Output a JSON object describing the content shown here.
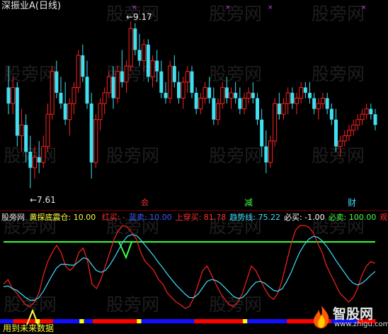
{
  "title": "深振业A(日线)",
  "price_high_label": "←9.17",
  "price_low_label": "←7.61",
  "signal_marks": {
    "red": "会",
    "jian": "减",
    "cai": "财"
  },
  "indicator_header": {
    "source_label": "股旁网",
    "name": "黄探底震仓:",
    "value": "10.00",
    "items": [
      {
        "label": "红买:",
        "value": "-",
        "color": "#ff3030"
      },
      {
        "label": "蓝卖:",
        "value": "10.00",
        "color": "#3a5bff"
      },
      {
        "label": "上穿买:",
        "value": "81.78",
        "color": "#ff3030"
      },
      {
        "label": "趋势线:",
        "value": "75.22",
        "color": "#40e0ff"
      },
      {
        "label": "必买:",
        "value": "-1.00",
        "color": "#ffffff"
      },
      {
        "label": "必卖:",
        "value": "100.00",
        "color": "#40ff40"
      },
      {
        "label": "观:",
        "value": "",
        "color": "#ff3030"
      }
    ]
  },
  "bottom_text": "用到未来数据",
  "watermark": "股旁网",
  "logo": {
    "name": "智股网",
    "url": "www.zhigu.com"
  },
  "colors": {
    "up": "#ff2020",
    "down": "#40e0f0",
    "green_line": "#40ff40",
    "red_line": "#ff2020",
    "cyan_line": "#40e0ff",
    "bar_blue": "#1010ff",
    "bar_red": "#ff0000",
    "bar_yellow": "#ffff00"
  },
  "chart_data": [
    {
      "type": "candlestick",
      "title": "深振业A(日线)",
      "annotations": [
        {
          "text": "9.17",
          "kind": "high"
        },
        {
          "text": "7.61",
          "kind": "low"
        }
      ],
      "candles": [
        [
          8.55,
          8.75,
          8.3,
          8.4
        ],
        [
          8.4,
          8.65,
          8.3,
          8.55
        ],
        [
          8.55,
          8.6,
          8.0,
          8.1
        ],
        [
          8.1,
          8.35,
          7.95,
          8.2
        ],
        [
          8.2,
          8.3,
          7.85,
          7.95
        ],
        [
          7.95,
          8.1,
          7.61,
          7.8
        ],
        [
          7.8,
          8.0,
          7.7,
          7.9
        ],
        [
          7.9,
          8.05,
          7.75,
          7.85
        ],
        [
          7.85,
          8.1,
          7.8,
          8.0
        ],
        [
          8.0,
          8.4,
          7.95,
          8.3
        ],
        [
          8.3,
          8.75,
          8.25,
          8.7
        ],
        [
          8.7,
          8.8,
          8.45,
          8.5
        ],
        [
          8.5,
          8.65,
          8.35,
          8.4
        ],
        [
          8.4,
          8.6,
          8.2,
          8.25
        ],
        [
          8.25,
          8.45,
          8.1,
          8.4
        ],
        [
          8.4,
          8.6,
          8.3,
          8.55
        ],
        [
          8.55,
          8.9,
          8.5,
          8.85
        ],
        [
          8.85,
          8.95,
          8.6,
          8.65
        ],
        [
          8.65,
          8.8,
          8.35,
          8.4
        ],
        [
          8.4,
          8.5,
          7.7,
          7.85
        ],
        [
          7.85,
          8.3,
          7.8,
          8.25
        ],
        [
          8.25,
          8.45,
          8.15,
          8.4
        ],
        [
          8.4,
          8.55,
          8.3,
          8.5
        ],
        [
          8.5,
          8.7,
          8.45,
          8.65
        ],
        [
          8.65,
          8.75,
          8.35,
          8.45
        ],
        [
          8.45,
          8.75,
          8.4,
          8.7
        ],
        [
          8.7,
          8.9,
          8.55,
          8.6
        ],
        [
          8.6,
          8.8,
          8.5,
          8.75
        ],
        [
          8.75,
          9.17,
          8.7,
          9.1
        ],
        [
          9.1,
          9.15,
          8.85,
          8.9
        ],
        [
          8.9,
          9.05,
          8.75,
          8.8
        ],
        [
          8.8,
          9.0,
          8.7,
          8.95
        ],
        [
          8.95,
          9.0,
          8.6,
          8.65
        ],
        [
          8.65,
          8.85,
          8.55,
          8.8
        ],
        [
          8.8,
          8.9,
          8.6,
          8.7
        ],
        [
          8.7,
          8.8,
          8.45,
          8.5
        ],
        [
          8.5,
          8.6,
          8.4,
          8.45
        ],
        [
          8.45,
          8.8,
          8.4,
          8.75
        ],
        [
          8.75,
          8.85,
          8.55,
          8.6
        ],
        [
          8.6,
          8.7,
          8.4,
          8.45
        ],
        [
          8.45,
          8.65,
          8.35,
          8.6
        ],
        [
          8.6,
          8.75,
          8.5,
          8.7
        ],
        [
          8.7,
          8.75,
          8.45,
          8.5
        ],
        [
          8.5,
          8.55,
          8.3,
          8.35
        ],
        [
          8.35,
          8.5,
          8.3,
          8.45
        ],
        [
          8.45,
          8.6,
          8.4,
          8.55
        ],
        [
          8.55,
          8.65,
          8.4,
          8.45
        ],
        [
          8.45,
          8.55,
          8.2,
          8.25
        ],
        [
          8.25,
          8.45,
          8.2,
          8.4
        ],
        [
          8.4,
          8.6,
          8.35,
          8.55
        ],
        [
          8.55,
          8.65,
          8.4,
          8.45
        ],
        [
          8.45,
          8.55,
          8.35,
          8.5
        ],
        [
          8.5,
          8.6,
          8.4,
          8.45
        ],
        [
          8.45,
          8.55,
          8.3,
          8.35
        ],
        [
          8.35,
          8.5,
          8.3,
          8.45
        ],
        [
          8.45,
          8.55,
          8.4,
          8.5
        ],
        [
          8.5,
          8.6,
          8.4,
          8.45
        ],
        [
          8.45,
          8.5,
          8.2,
          8.25
        ],
        [
          8.25,
          8.35,
          7.9,
          8.0
        ],
        [
          8.0,
          8.15,
          7.75,
          7.85
        ],
        [
          7.85,
          8.1,
          7.8,
          8.05
        ],
        [
          8.05,
          8.45,
          8.0,
          8.4
        ],
        [
          8.4,
          8.5,
          8.25,
          8.3
        ],
        [
          8.3,
          8.45,
          8.25,
          8.4
        ],
        [
          8.4,
          8.55,
          8.3,
          8.5
        ],
        [
          8.5,
          8.55,
          8.35,
          8.4
        ],
        [
          8.4,
          8.5,
          8.3,
          8.45
        ],
        [
          8.45,
          8.6,
          8.4,
          8.55
        ],
        [
          8.55,
          8.6,
          8.45,
          8.5
        ],
        [
          8.5,
          8.6,
          8.4,
          8.45
        ],
        [
          8.45,
          8.5,
          8.3,
          8.35
        ],
        [
          8.35,
          8.45,
          8.25,
          8.4
        ],
        [
          8.4,
          8.5,
          8.35,
          8.45
        ],
        [
          8.45,
          8.5,
          8.3,
          8.35
        ],
        [
          8.35,
          8.4,
          8.2,
          8.25
        ],
        [
          8.25,
          8.35,
          7.95,
          8.0
        ],
        [
          8.0,
          8.1,
          7.9,
          8.05
        ],
        [
          8.05,
          8.15,
          8.0,
          8.1
        ],
        [
          8.1,
          8.2,
          8.05,
          8.15
        ],
        [
          8.15,
          8.25,
          8.1,
          8.2
        ],
        [
          8.2,
          8.3,
          8.15,
          8.25
        ],
        [
          8.25,
          8.35,
          8.2,
          8.3
        ],
        [
          8.3,
          8.4,
          8.25,
          8.35
        ],
        [
          8.35,
          8.4,
          8.25,
          8.3
        ],
        [
          8.3,
          8.35,
          8.15,
          8.2
        ]
      ]
    },
    {
      "type": "line",
      "ylim": [
        0,
        100
      ],
      "reference_line": 81.78,
      "series": [
        {
          "name": "上穿买",
          "color": "#ff2020",
          "values": [
            35,
            40,
            30,
            25,
            18,
            12,
            10,
            15,
            25,
            45,
            60,
            70,
            78,
            70,
            55,
            50,
            55,
            70,
            75,
            60,
            35,
            30,
            40,
            55,
            70,
            85,
            95,
            100,
            98,
            92,
            85,
            70,
            60,
            55,
            50,
            40,
            35,
            25,
            20,
            15,
            12,
            8,
            10,
            20,
            35,
            50,
            55,
            45,
            35,
            25,
            18,
            12,
            10,
            15,
            25,
            40,
            55,
            50,
            40,
            30,
            22,
            18,
            25,
            40,
            60,
            80,
            95,
            100,
            100,
            98,
            92,
            80,
            70,
            55,
            45,
            35,
            25,
            20,
            15,
            20,
            30,
            45,
            55,
            60,
            58
          ]
        },
        {
          "name": "趋势线",
          "color": "#40e0ff",
          "values": [
            32,
            33,
            30,
            28,
            24,
            20,
            17,
            17,
            20,
            27,
            36,
            45,
            53,
            57,
            57,
            56,
            56,
            60,
            64,
            63,
            56,
            50,
            48,
            50,
            56,
            64,
            73,
            82,
            88,
            90,
            89,
            84,
            78,
            72,
            66,
            59,
            53,
            46,
            40,
            34,
            29,
            24,
            20,
            20,
            24,
            31,
            38,
            40,
            39,
            36,
            31,
            26,
            21,
            19,
            20,
            25,
            32,
            37,
            38,
            36,
            32,
            28,
            27,
            30,
            38,
            48,
            60,
            71,
            79,
            85,
            88,
            87,
            83,
            77,
            70,
            62,
            55,
            48,
            41,
            36,
            34,
            36,
            40,
            45,
            49
          ]
        }
      ]
    }
  ],
  "signal_bar": [
    "b",
    "b",
    "b",
    "r",
    "r",
    "r",
    "r",
    "r",
    "y",
    "r",
    "r",
    "r",
    "b",
    "b",
    "b",
    "b",
    "b",
    "b",
    "y",
    "b",
    "b",
    "r",
    "r",
    "r",
    "r",
    "r",
    "r",
    "r",
    "r",
    "r",
    "r",
    "y",
    "b",
    "b",
    "b",
    "b",
    "b",
    "b",
    "b",
    "b",
    "b",
    "b",
    "b",
    "b",
    "r",
    "r",
    "r",
    "r",
    "r",
    "r",
    "r",
    "r",
    "r",
    "r",
    "r",
    "y",
    "b",
    "b",
    "b",
    "b",
    "b",
    "b",
    "b",
    "b",
    "b",
    "r",
    "r",
    "r",
    "r",
    "r",
    "r",
    "r",
    "r",
    "r",
    "r",
    "b",
    "b",
    "b",
    "b",
    "b",
    "b",
    "r",
    "r",
    "r",
    "r"
  ]
}
